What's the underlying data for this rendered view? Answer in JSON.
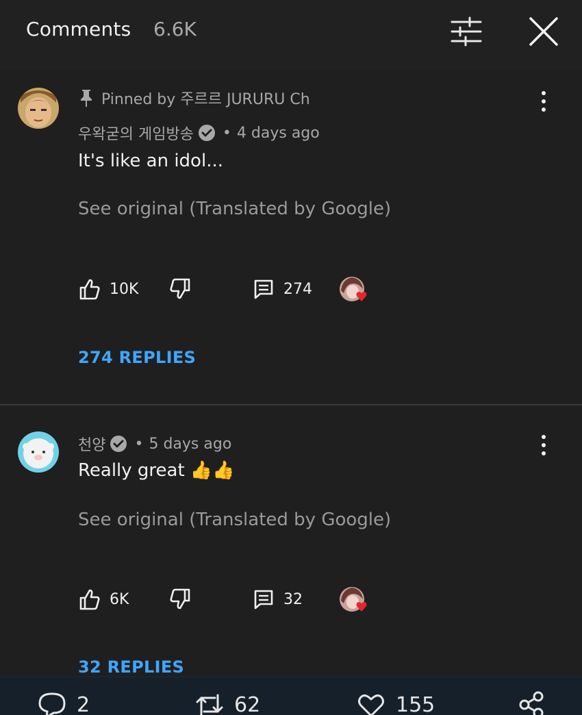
{
  "header": {
    "title": "Comments",
    "count": "6.6K",
    "filter_icon": "sliders-icon",
    "close_icon": "close-icon"
  },
  "comments": [
    {
      "pinned_label": "Pinned by 주르르 JURURU Ch",
      "author": "우왁굳의 게임방송",
      "verified": true,
      "time": "4 days ago",
      "text": "It's like an idol...",
      "see_original": "See original (Translated by Google)",
      "likes": "10K",
      "reply_count": "274",
      "replies_label": "274 REPLIES"
    },
    {
      "author": "천양",
      "verified": true,
      "time": "5 days ago",
      "text": "Really great 👍👍",
      "see_original": "See original (Translated by Google)",
      "likes": "6K",
      "reply_count": "32",
      "replies_label": "32 REPLIES"
    }
  ],
  "bottom_bar": {
    "replies": "2",
    "retweets": "62",
    "likes": "155"
  },
  "colors": {
    "background": "#1f1f1f",
    "link": "#3ea6ff",
    "bottom_bar": "#15202b",
    "heart": "#e8242b"
  }
}
